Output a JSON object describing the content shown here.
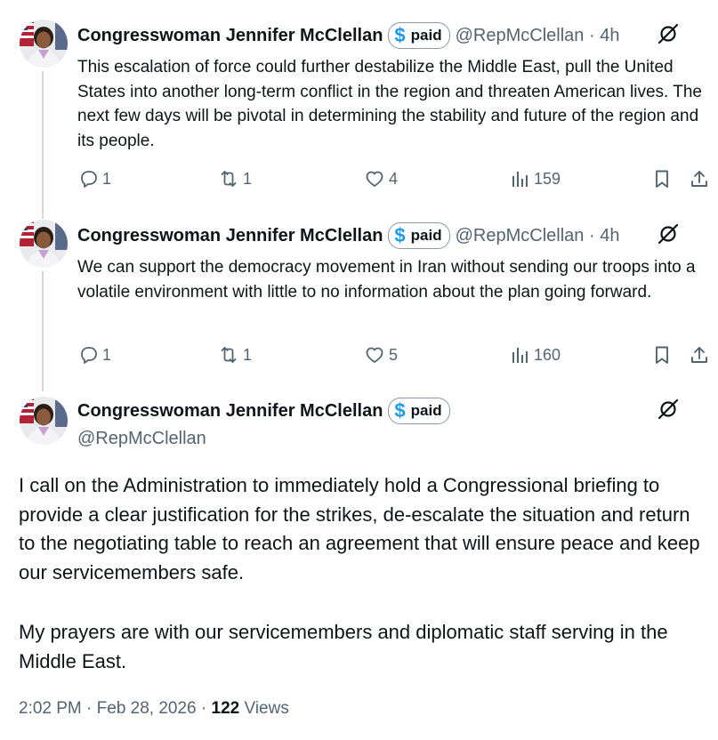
{
  "tweets": [
    {
      "name": "Congresswoman Jennifer McClellan",
      "badge_symbol": "$",
      "badge_label": "paid",
      "handle_time": "@RepMcClellan · 4h",
      "text": "This escalation of force could further destabilize the Middle East, pull the United States into another long-term conflict in the region and threaten American lives. The next few days will be pivotal in determining the stability and future of the region and its people.",
      "replies": "1",
      "reposts": "1",
      "likes": "4",
      "views": "159"
    },
    {
      "name": "Congresswoman Jennifer McClellan",
      "badge_symbol": "$",
      "badge_label": "paid",
      "handle_time": "@RepMcClellan · 4h",
      "text": "We can support the democracy movement in Iran without sending our troops into a volatile environment with little to no information about the plan going forward.",
      "replies": "1",
      "reposts": "1",
      "likes": "5",
      "views": "160"
    }
  ],
  "main": {
    "name": "Congresswoman Jennifer McClellan",
    "badge_symbol": "$",
    "badge_label": "paid",
    "handle": "@RepMcClellan",
    "paragraph1": "I call on the Administration to immediately hold a Congressional briefing to provide a clear justification for the strikes, de-escalate the situation and return to the negotiating table to reach an agreement that will ensure peace and keep our servicemembers safe.",
    "paragraph2": "My prayers are with our servicemembers and diplomatic staff serving in the Middle East.",
    "timestamp": "2:02 PM · Feb 28, 2026 · ",
    "views_count": "122",
    "views_label": "Views"
  },
  "icons": {
    "more": "grok-slash-icon",
    "reply": "reply-bubble-icon",
    "repost": "repost-arrows-icon",
    "like": "heart-icon",
    "views": "bar-chart-icon",
    "bookmark": "bookmark-icon",
    "share": "share-upload-icon"
  },
  "colors": {
    "text": "#0f1419",
    "secondary": "#536471",
    "accent": "#1d9bf0",
    "thread_line": "#cfd9de"
  }
}
